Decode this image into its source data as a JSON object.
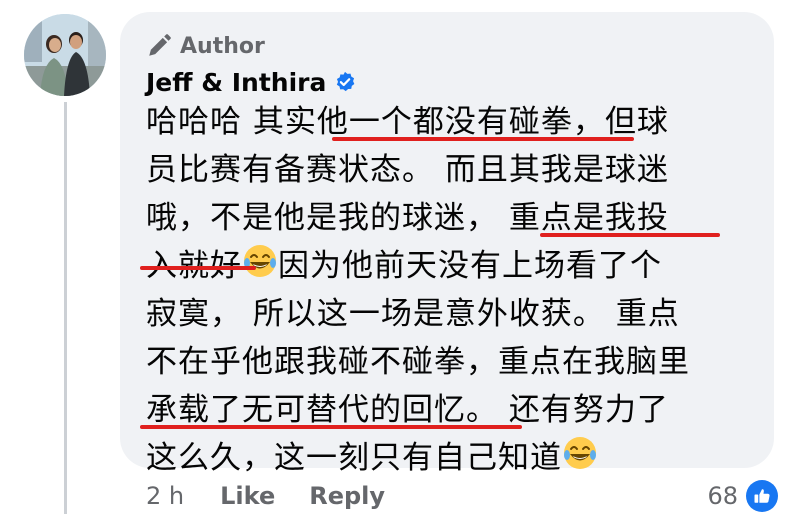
{
  "comment": {
    "author_badge": "Author",
    "author_name": "Jeff & Inthira",
    "lines": [
      "哈哈哈 其实他一个都没有碰拳，但球",
      "员比赛有备赛状态。 而且其我是球迷",
      "哦，不是他是我的球迷， 重点是我投",
      "入就好",
      "因为他前天没有上场看了个",
      "寂寞， 所以这一场是意外收获。 重点",
      "不在乎他跟我碰不碰拳，重点在我脑里",
      "承载了无可替代的回忆。 还有努力了",
      "这么久，这一刻只有自己知道"
    ],
    "emoji_1": "laughing-crying-emoji",
    "emoji_2": "laughing-crying-emoji"
  },
  "footer": {
    "time": "2 h",
    "like_label": "Like",
    "reply_label": "Reply",
    "reaction_count": "68"
  },
  "colors": {
    "bubble": "#f0f2f5",
    "text": "#050505",
    "secondary": "#65676b",
    "verified": "#1877f2",
    "highlight_underline": "#e0201e"
  },
  "icons": {
    "author": "pencil-icon",
    "verified": "verified-badge-icon",
    "reaction": "like-thumb-icon"
  }
}
